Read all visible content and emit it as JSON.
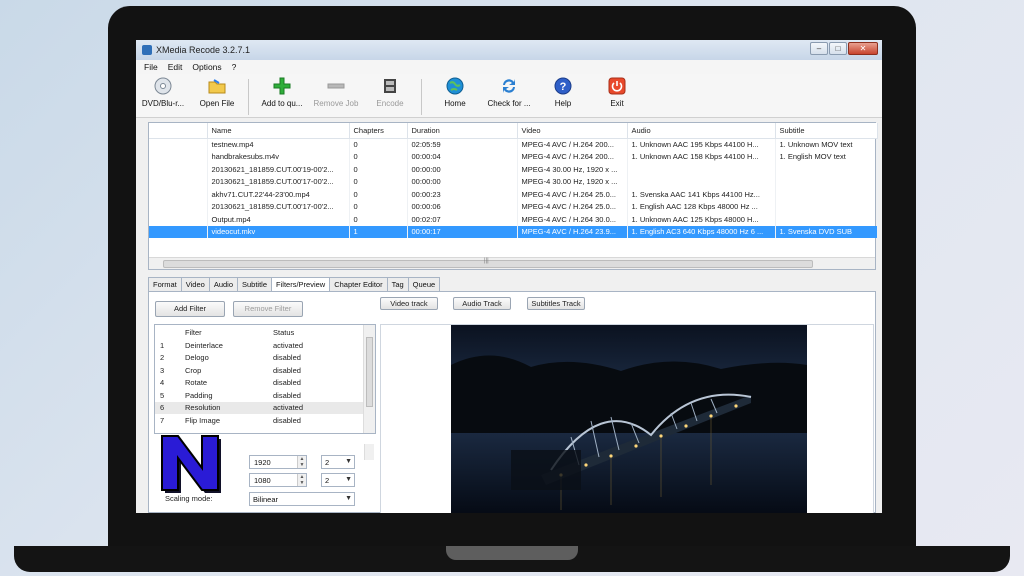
{
  "window": {
    "title": "XMedia Recode 3.2.7.1",
    "controls": {
      "minimize": "–",
      "maximize": "□",
      "close": "✕"
    }
  },
  "menu": [
    "File",
    "Edit",
    "Options",
    "?"
  ],
  "toolbar": [
    {
      "label": "DVD/Blu-r...",
      "icon": "disc-icon",
      "enabled": true
    },
    {
      "label": "Open File",
      "icon": "folder-icon",
      "enabled": true
    },
    {
      "label": "Add to qu...",
      "icon": "plus-icon",
      "enabled": true
    },
    {
      "label": "Remove Job",
      "icon": "minus-icon",
      "enabled": false
    },
    {
      "label": "Encode",
      "icon": "film-icon",
      "enabled": false
    },
    {
      "label": "Home",
      "icon": "globe-icon",
      "enabled": true
    },
    {
      "label": "Check for ...",
      "icon": "refresh-icon",
      "enabled": true
    },
    {
      "label": "Help",
      "icon": "help-icon",
      "enabled": true
    },
    {
      "label": "Exit",
      "icon": "power-icon",
      "enabled": true
    }
  ],
  "files": {
    "columns": [
      "Name",
      "Chapters",
      "Duration",
      "Video",
      "Audio",
      "Subtitle"
    ],
    "rows": [
      [
        "testnew.mp4",
        "0",
        "02:05:59",
        "MPEG-4 AVC / H.264 200...",
        "1. Unknown AAC  195 Kbps 44100 H...",
        "1. Unknown MOV text"
      ],
      [
        "handbrakesubs.m4v",
        "0",
        "00:00:04",
        "MPEG-4 AVC / H.264 200...",
        "1. Unknown AAC  158 Kbps 44100 H...",
        "1. English MOV text"
      ],
      [
        "20130621_181859.CUT.00'19-00'2...",
        "0",
        "00:00:00",
        "MPEG-4 30.00 Hz, 1920 x ...",
        "",
        ""
      ],
      [
        "20130621_181859.CUT.00'17-00'2...",
        "0",
        "00:00:00",
        "MPEG-4 30.00 Hz, 1920 x ...",
        "",
        ""
      ],
      [
        "akhv71.CUT.22'44-23'00.mp4",
        "0",
        "00:00:23",
        "MPEG-4 AVC / H.264 25.0...",
        "1. Svenska AAC  141 Kbps 44100 Hz...",
        ""
      ],
      [
        "20130621_181859.CUT.00'17-00'2...",
        "0",
        "00:00:06",
        "MPEG-4 AVC / H.264 25.0...",
        "1. English AAC  128 Kbps 48000 Hz ...",
        ""
      ],
      [
        "Output.mp4",
        "0",
        "00:02:07",
        "MPEG-4 AVC / H.264 30.0...",
        "1. Unknown AAC  125 Kbps 48000 H...",
        ""
      ],
      [
        "videocut.mkv",
        "1",
        "00:00:17",
        "MPEG-4 AVC / H.264 23.9...",
        "1. English AC3 640 Kbps 48000 Hz 6 ...",
        "1. Svenska DVD SUB"
      ]
    ],
    "selected_index": 7
  },
  "tabs": {
    "items": [
      "Format",
      "Video",
      "Audio",
      "Subtitle",
      "Filters/Preview",
      "Chapter Editor",
      "Tag",
      "Queue"
    ],
    "active": "Filters/Preview"
  },
  "filters_panel": {
    "add_filter": "Add Filter",
    "remove_filter": "Remove Filter",
    "columns": [
      "",
      "Filter",
      "Status"
    ],
    "rows": [
      [
        "1",
        "Deinterlace",
        "activated"
      ],
      [
        "2",
        "Delogo",
        "disabled"
      ],
      [
        "3",
        "Crop",
        "disabled"
      ],
      [
        "4",
        "Rotate",
        "disabled"
      ],
      [
        "5",
        "Padding",
        "disabled"
      ],
      [
        "6",
        "Resolution",
        "activated"
      ],
      [
        "7",
        "Flip Image",
        "disabled"
      ]
    ],
    "width_value": "1920",
    "height_value": "1080",
    "width_mult": "2",
    "height_mult": "2",
    "scaling_label": "Scaling mode:",
    "scaling_value": "Bilinear"
  },
  "preview": {
    "video_track": "Video track",
    "audio_track": "Audio Track",
    "subtitles_track": "Subtitles Track"
  },
  "colors": {
    "selection": "#3399ff",
    "logo": "#2a1bd6"
  }
}
